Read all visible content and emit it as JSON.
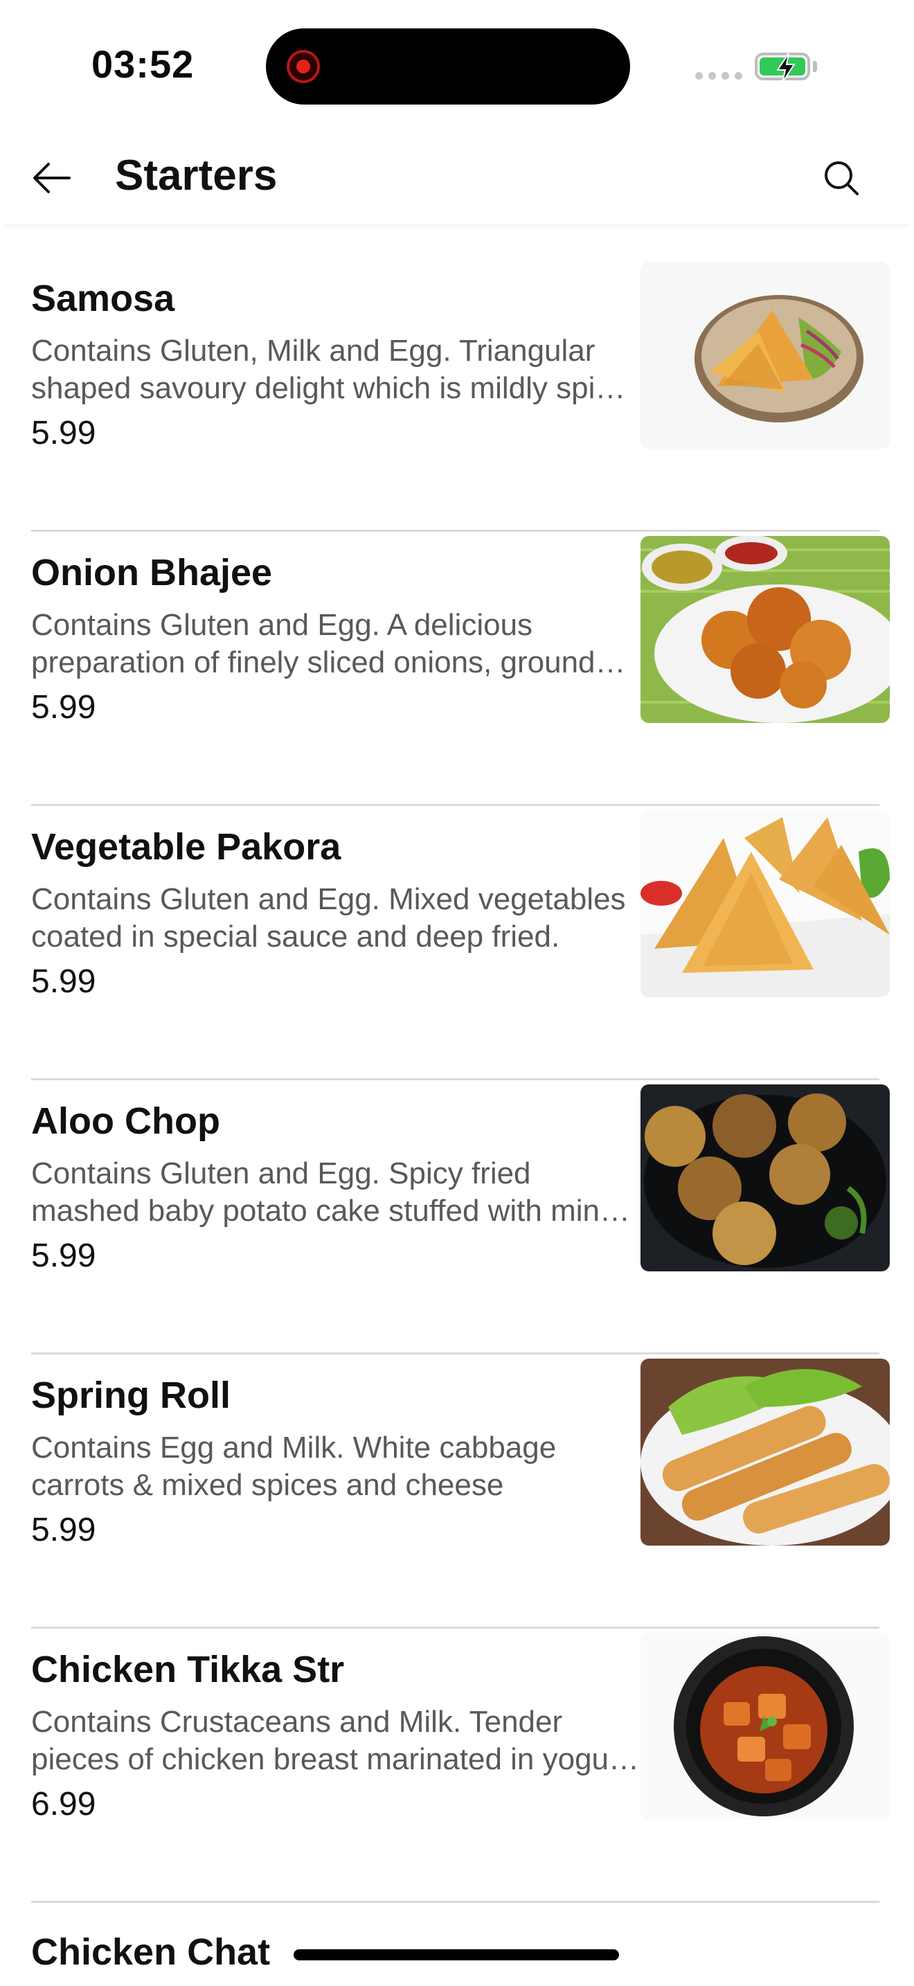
{
  "status_bar": {
    "time": "03:52"
  },
  "header": {
    "title": "Starters"
  },
  "items": [
    {
      "name": "Samosa",
      "desc_line1": "Contains Gluten, Milk and Egg. Triangular",
      "desc_line2": "shaped savoury delight which is mildly spic…",
      "price": "5.99"
    },
    {
      "name": "Onion Bhajee",
      "desc_line1": "Contains Gluten and Egg. A delicious",
      "desc_line2": "preparation of finely sliced onions, ground…",
      "price": "5.99"
    },
    {
      "name": "Vegetable Pakora",
      "desc_line1": "Contains Gluten and Egg. Mixed vegetables",
      "desc_line2": "coated in special sauce and deep fried.",
      "price": "5.99"
    },
    {
      "name": "Aloo Chop",
      "desc_line1": "Contains Gluten and Egg. Spicy fried",
      "desc_line2": "mashed baby potato cake stuffed with min…",
      "price": "5.99"
    },
    {
      "name": "Spring Roll",
      "desc_line1": "Contains Egg and Milk. White cabbage",
      "desc_line2": "carrots & mixed spices and cheese",
      "price": "5.99"
    },
    {
      "name": "Chicken Tikka Str",
      "desc_line1": "Contains Crustaceans and Milk. Tender",
      "desc_line2": "pieces of chicken breast marinated in yogu…",
      "price": "6.99"
    }
  ],
  "partial_item": {
    "name": "Chicken Chat"
  },
  "colors": {
    "battery": "#34c759",
    "divider": "#dadada",
    "description_text": "#595959"
  },
  "icons": {
    "back": "arrow-left-icon",
    "search": "search-icon"
  }
}
